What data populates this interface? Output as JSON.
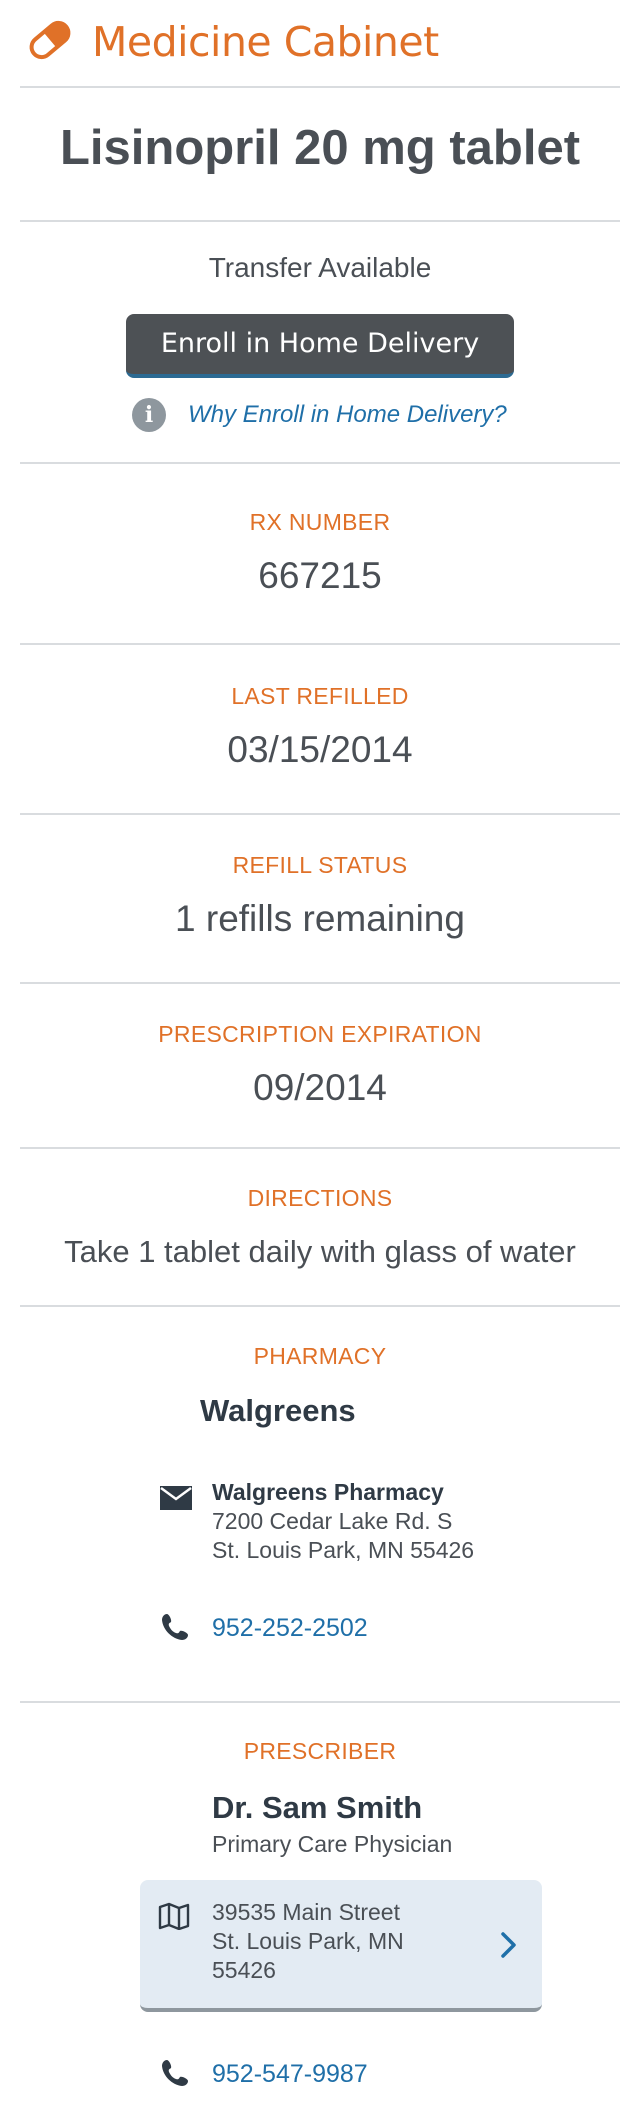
{
  "header": {
    "title": "Medicine Cabinet",
    "icon": "pill-icon",
    "accent_color": "#e07128"
  },
  "prescription": {
    "drug_name": "Lisinopril 20 mg tablet",
    "transfer_status": "Transfer Available",
    "enroll_button": "Enroll in Home Delivery",
    "why_enroll_link": "Why Enroll in Home Delivery?",
    "fields": [
      {
        "label": "RX NUMBER",
        "value": "667215"
      },
      {
        "label": "LAST REFILLED",
        "value": "03/15/2014"
      },
      {
        "label": "REFILL STATUS",
        "value": "1 refills remaining"
      },
      {
        "label": "PRESCRIPTION EXPIRATION",
        "value": "09/2014"
      },
      {
        "label": "DIRECTIONS",
        "value": "Take 1 tablet daily with glass of water"
      }
    ]
  },
  "pharmacy": {
    "label": "PHARMACY",
    "name": "Walgreens",
    "address_name": "Walgreens Pharmacy",
    "address_line1": "7200 Cedar Lake Rd. S",
    "address_line2": "St. Louis Park, MN 55426",
    "phone": "952-252-2502"
  },
  "prescriber": {
    "label": "PRESCRIBER",
    "name": "Dr. Sam Smith",
    "role": "Primary Care Physician",
    "address_line1": "39535 Main Street",
    "address_line2": "St. Louis Park, MN",
    "address_line3": "55426",
    "phone": "952-547-9987"
  },
  "colors": {
    "link": "#1f6fa8",
    "button_bg": "#4d5155",
    "card_bg": "#e3ebf3"
  }
}
